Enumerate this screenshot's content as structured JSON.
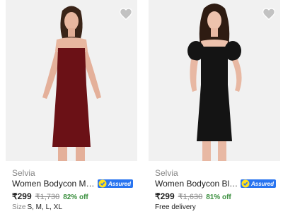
{
  "products": [
    {
      "brand": "Selvia",
      "title": "Women Bodycon Maroon D...",
      "assured_label": "Assured",
      "price": "₹299",
      "mrp": "₹1,730",
      "discount": "82% off",
      "size_label": "Size",
      "sizes": "S, M, L, XL",
      "dress_color": "#6b1116"
    },
    {
      "brand": "Selvia",
      "title": "Women Bodycon Black Dre...",
      "assured_label": "Assured",
      "price": "₹299",
      "mrp": "₹1,630",
      "discount": "81% off",
      "delivery": "Free delivery",
      "dress_color": "#141414"
    }
  ],
  "colors": {
    "accent": "#2874f0",
    "discount_green": "#388e3c",
    "muted_text": "#878787",
    "wishlist_icon": "#c2c2c2"
  }
}
